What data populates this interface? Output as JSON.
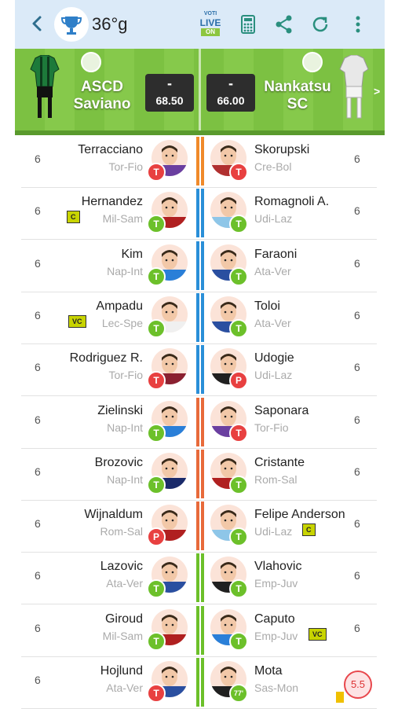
{
  "header": {
    "temperature": "36°g",
    "voti_label_top": "VOTI",
    "voti_label_mid": "LIVE",
    "voti_label_bottom": "ON"
  },
  "match": {
    "home": {
      "name_line1": "ASCD",
      "name_line2": "Saviano",
      "goals": "-",
      "points": "68.50",
      "kit_color": "#1d7a3a"
    },
    "away": {
      "name_line1": "Nankatsu",
      "name_line2": "SC",
      "goals": "-",
      "points": "66.00",
      "kit_color": "#e8e8e8"
    },
    "next_arrow": ">"
  },
  "players": [
    {
      "home": {
        "vote": "6",
        "name": "Terracciano",
        "club": "Tor-Fio",
        "status": "T",
        "status_color": "#e84040",
        "shirt": "#6a3fa0",
        "bar": "#f08a2a"
      },
      "away": {
        "vote": "6",
        "name": "Skorupski",
        "club": "Cre-Bol",
        "status": "T",
        "status_color": "#e84040",
        "shirt": "#b03030",
        "bar": "#f08a2a"
      }
    },
    {
      "home": {
        "vote": "6",
        "name": "Hernandez",
        "club": "Mil-Sam",
        "tag": "C",
        "status": "T",
        "status_color": "#6cc02a",
        "shirt": "#b02020",
        "bar": "#2a8fd8"
      },
      "away": {
        "vote": "6",
        "name": "Romagnoli A.",
        "club": "Udi-Laz",
        "status": "T",
        "status_color": "#6cc02a",
        "shirt": "#8ec6e8",
        "bar": "#2a8fd8"
      }
    },
    {
      "home": {
        "vote": "6",
        "name": "Kim",
        "club": "Nap-Int",
        "status": "T",
        "status_color": "#6cc02a",
        "shirt": "#2a7fd8",
        "bar": "#2a8fd8"
      },
      "away": {
        "vote": "6",
        "name": "Faraoni",
        "club": "Ata-Ver",
        "status": "T",
        "status_color": "#6cc02a",
        "shirt": "#2a4fa0",
        "bar": "#2a8fd8"
      }
    },
    {
      "home": {
        "vote": "6",
        "name": "Ampadu",
        "club": "Lec-Spe",
        "tag": "VC",
        "status": "T",
        "status_color": "#6cc02a",
        "shirt": "#f0f0f0",
        "bar": "#2a8fd8"
      },
      "away": {
        "vote": "6",
        "name": "Toloi",
        "club": "Ata-Ver",
        "status": "T",
        "status_color": "#6cc02a",
        "shirt": "#2a4fa0",
        "bar": "#2a8fd8"
      }
    },
    {
      "home": {
        "vote": "6",
        "name": "Rodriguez R.",
        "club": "Tor-Fio",
        "status": "T",
        "status_color": "#e84040",
        "shirt": "#8a2030",
        "bar": "#2a8fd8"
      },
      "away": {
        "vote": "6",
        "name": "Udogie",
        "club": "Udi-Laz",
        "status": "P",
        "status_color": "#e84040",
        "shirt": "#202020",
        "bar": "#2a8fd8"
      }
    },
    {
      "home": {
        "vote": "6",
        "name": "Zielinski",
        "club": "Nap-Int",
        "status": "T",
        "status_color": "#6cc02a",
        "shirt": "#2a7fd8",
        "bar": "#e86a3a"
      },
      "away": {
        "vote": "6",
        "name": "Saponara",
        "club": "Tor-Fio",
        "status": "T",
        "status_color": "#e84040",
        "shirt": "#6a3fa0",
        "bar": "#e86a3a"
      }
    },
    {
      "home": {
        "vote": "6",
        "name": "Brozovic",
        "club": "Nap-Int",
        "status": "T",
        "status_color": "#6cc02a",
        "shirt": "#1a2a6a",
        "bar": "#e86a3a"
      },
      "away": {
        "vote": "6",
        "name": "Cristante",
        "club": "Rom-Sal",
        "status": "T",
        "status_color": "#6cc02a",
        "shirt": "#b02020",
        "bar": "#e86a3a"
      }
    },
    {
      "home": {
        "vote": "6",
        "name": "Wijnaldum",
        "club": "Rom-Sal",
        "status": "P",
        "status_color": "#e84040",
        "shirt": "#b02020",
        "bar": "#e86a3a"
      },
      "away": {
        "vote": "6",
        "name": "Felipe Anderson",
        "club": "Udi-Laz",
        "tag": "C",
        "status": "T",
        "status_color": "#6cc02a",
        "shirt": "#8ec6e8",
        "bar": "#e86a3a"
      }
    },
    {
      "home": {
        "vote": "6",
        "name": "Lazovic",
        "club": "Ata-Ver",
        "status": "T",
        "status_color": "#6cc02a",
        "shirt": "#2a4fa0",
        "bar": "#6cc02a"
      },
      "away": {
        "vote": "6",
        "name": "Vlahovic",
        "club": "Emp-Juv",
        "status": "T",
        "status_color": "#6cc02a",
        "shirt": "#202020",
        "bar": "#6cc02a"
      }
    },
    {
      "home": {
        "vote": "6",
        "name": "Giroud",
        "club": "Mil-Sam",
        "status": "T",
        "status_color": "#6cc02a",
        "shirt": "#b02020",
        "bar": "#6cc02a"
      },
      "away": {
        "vote": "6",
        "name": "Caputo",
        "club": "Emp-Juv",
        "tag": "VC",
        "status": "T",
        "status_color": "#6cc02a",
        "shirt": "#2a7fd8",
        "bar": "#6cc02a"
      }
    },
    {
      "home": {
        "vote": "6",
        "name": "Hojlund",
        "club": "Ata-Ver",
        "status": "T",
        "status_color": "#e84040",
        "shirt": "#2a4fa0",
        "bar": "#6cc02a"
      },
      "away": {
        "vote": "",
        "name": "Mota",
        "club": "Sas-Mon",
        "status": "77'",
        "status_color": "#6cc02a",
        "shirt": "#202020",
        "bar": "#6cc02a",
        "rating": "5.5"
      }
    }
  ],
  "icons": {
    "back": "chevron-left-icon",
    "trophy": "trophy-icon",
    "calculator": "calculator-icon",
    "share": "share-icon",
    "refresh": "refresh-icon",
    "menu": "more-vertical-icon"
  }
}
